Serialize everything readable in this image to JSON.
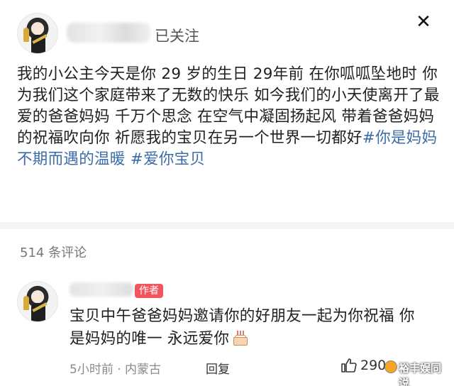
{
  "post": {
    "follow_status": "已关注",
    "close_icon": "✕",
    "body_text": "我的小公主今天是你 29 岁的生日 29年前 在你呱呱坠地时 你为我们这个家庭带来了无数的快乐 如今我们的小天使离开了最爱的爸爸妈妈 千万个思念 在空气中凝固扬起风 带着爸爸妈妈的祝福吹向你 祈愿我的宝贝在另一个世界一切都好",
    "hashtags": [
      "#你是妈妈不期而遇的温暖",
      "#爱你宝贝"
    ]
  },
  "comments_section": {
    "count_label": "514 条评论"
  },
  "comment": {
    "author_badge": "作者",
    "text": "宝贝中午爸爸妈妈邀请你的好朋友一起为你祝福 你是妈妈的唯一 永远爱你",
    "meta": "5小时前 · 内蒙古",
    "reply_label": "回复",
    "like_count": "290",
    "cake_icon": "birthday-cake-icon"
  },
  "watermark": {
    "text": "裕丰娱同说"
  },
  "colors": {
    "hashtag": "#3b6ca8",
    "badge": "#f0555b",
    "divider": "#f4f4f4"
  }
}
